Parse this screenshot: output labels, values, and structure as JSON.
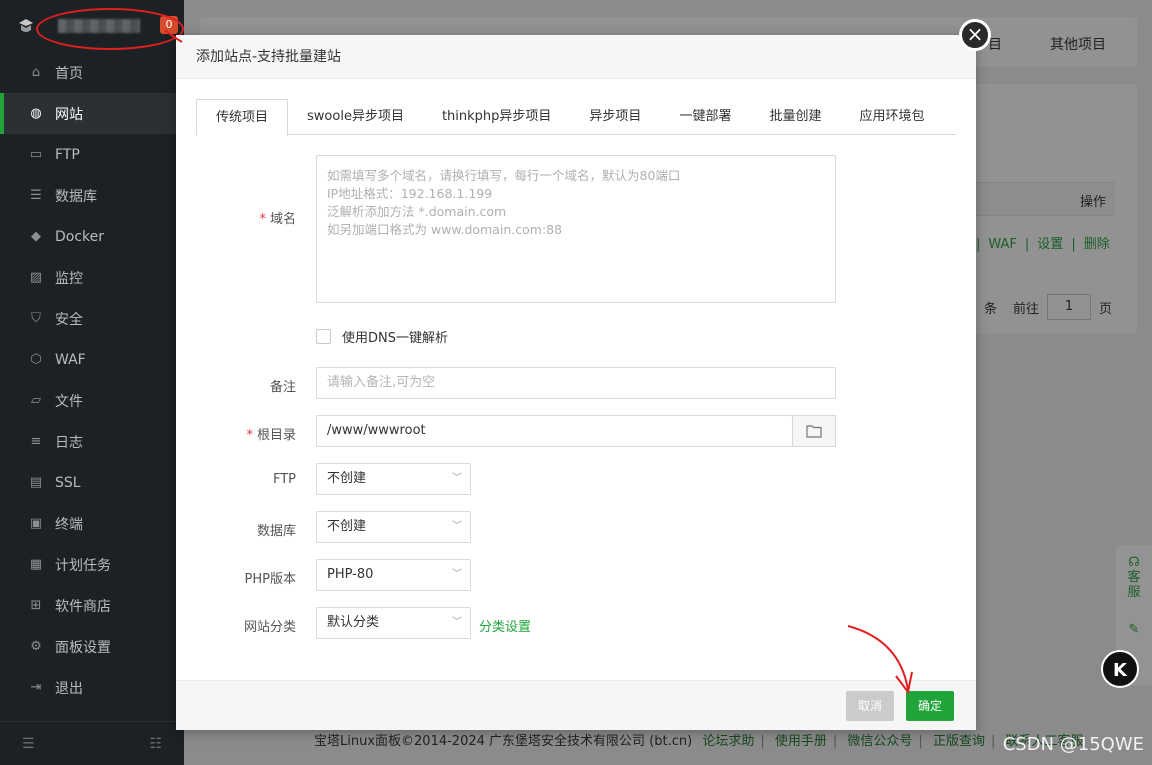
{
  "sidebar": {
    "badge": "0",
    "items": [
      {
        "label": "首页",
        "icon": "home-icon",
        "glyph": "⌂"
      },
      {
        "label": "网站",
        "icon": "globe-icon",
        "glyph": "◍",
        "active": true
      },
      {
        "label": "FTP",
        "icon": "ftp-icon",
        "glyph": "▭"
      },
      {
        "label": "数据库",
        "icon": "database-icon",
        "glyph": "☰"
      },
      {
        "label": "Docker",
        "icon": "docker-icon",
        "glyph": "◆"
      },
      {
        "label": "监控",
        "icon": "monitor-icon",
        "glyph": "▨"
      },
      {
        "label": "安全",
        "icon": "shield-icon",
        "glyph": "⛉"
      },
      {
        "label": "WAF",
        "icon": "waf-icon",
        "glyph": "⬡"
      },
      {
        "label": "文件",
        "icon": "folder-icon",
        "glyph": "▱"
      },
      {
        "label": "日志",
        "icon": "log-icon",
        "glyph": "≡"
      },
      {
        "label": "SSL",
        "icon": "ssl-icon",
        "glyph": "▤"
      },
      {
        "label": "终端",
        "icon": "terminal-icon",
        "glyph": "▣"
      },
      {
        "label": "计划任务",
        "icon": "calendar-icon",
        "glyph": "▦"
      },
      {
        "label": "软件商店",
        "icon": "apps-icon",
        "glyph": "⊞"
      },
      {
        "label": "面板设置",
        "icon": "gear-icon",
        "glyph": "⚙"
      },
      {
        "label": "退出",
        "icon": "logout-icon",
        "glyph": "⇥"
      }
    ]
  },
  "background": {
    "tab_partial": "目",
    "tab_other": "其他项目",
    "table_op_header": "操作",
    "row_actions": [
      "WAF",
      "设置",
      "删除"
    ],
    "pager": {
      "unit": "条",
      "goto": "前往",
      "page": "1",
      "page_unit": "页"
    },
    "footer": {
      "copyright": "宝塔Linux面板©2014-2024 广东堡塔安全技术有限公司 (bt.cn)",
      "links": [
        "论坛求助",
        "使用手册",
        "微信公众号",
        "正版查询",
        "联系人工客服"
      ]
    },
    "side_widget": [
      "客",
      "服"
    ],
    "watermark": "CSDN @15QWE",
    "k_badge": "K"
  },
  "modal": {
    "title": "添加站点-支持批量建站",
    "tabs": [
      "传统项目",
      "swoole异步项目",
      "thinkphp异步项目",
      "异步项目",
      "一键部署",
      "批量创建",
      "应用环境包"
    ],
    "domain": {
      "label": "域名",
      "placeholder_lines": [
        "如需填写多个域名，请换行填写，每行一个域名，默认为80端口",
        "IP地址格式：192.168.1.199",
        "泛解析添加方法 *.domain.com",
        "如另加端口格式为 www.domain.com:88"
      ]
    },
    "dns_checkbox": "使用DNS一键解析",
    "remark": {
      "label": "备注",
      "placeholder": "请输入备注,可为空"
    },
    "root": {
      "label": "根目录",
      "value": "/www/wwwroot"
    },
    "ftp": {
      "label": "FTP",
      "value": "不创建"
    },
    "database": {
      "label": "数据库",
      "value": "不创建"
    },
    "php": {
      "label": "PHP版本",
      "value": "PHP-80"
    },
    "category": {
      "label": "网站分类",
      "value": "默认分类",
      "link": "分类设置"
    },
    "buttons": {
      "cancel": "取消",
      "ok": "确定"
    }
  }
}
